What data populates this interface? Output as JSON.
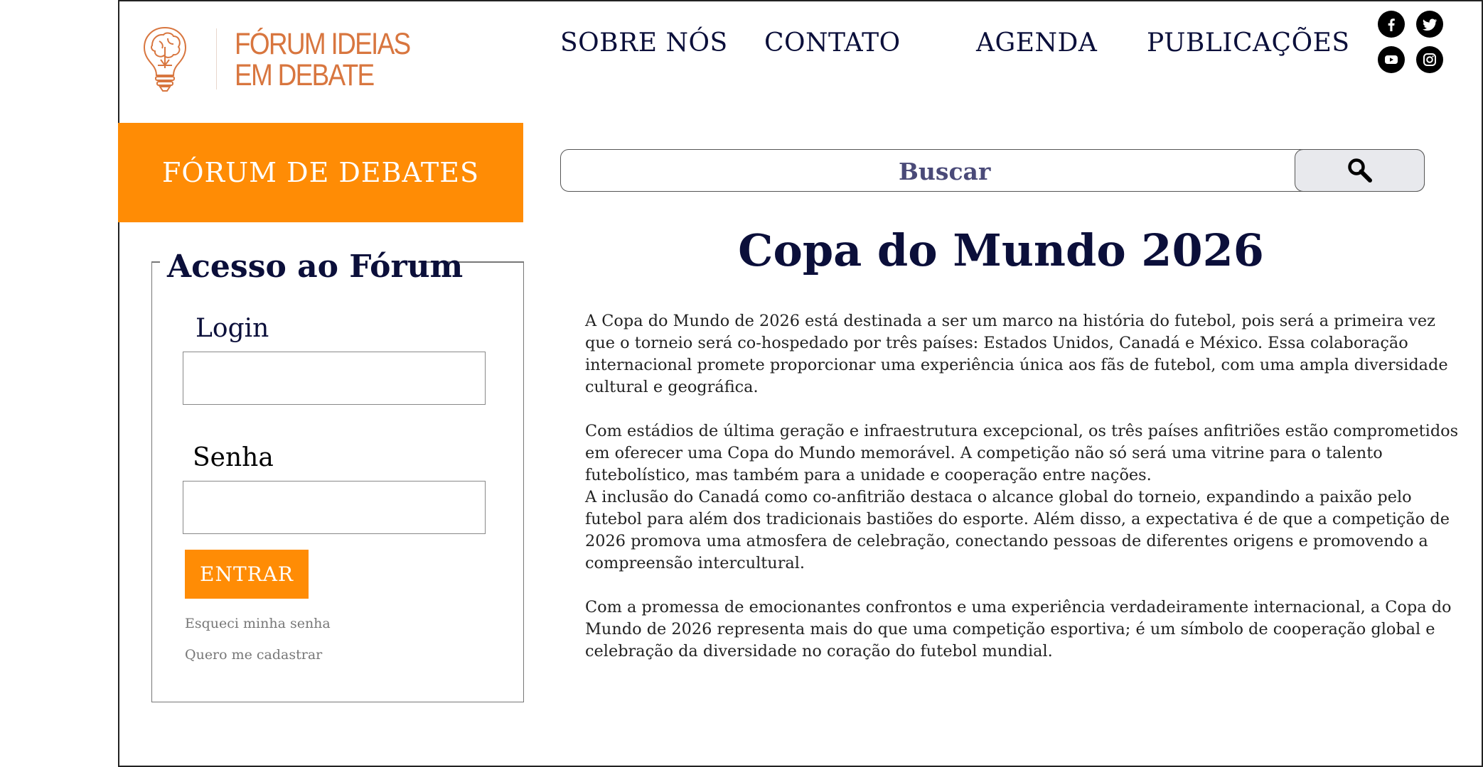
{
  "header": {
    "logo_text_line1": "FÓRUM IDEIAS",
    "logo_text_line2": "EM DEBATE",
    "nav": [
      "SOBRE NÓS",
      "CONTATO",
      "AGENDA",
      "PUBLICAÇÕES"
    ],
    "social_icons": [
      "facebook-icon",
      "twitter-icon",
      "youtube-icon",
      "instagram-icon"
    ]
  },
  "sidebar": {
    "banner": "FÓRUM DE DEBATES",
    "access_title": "Acesso ao Fórum",
    "login_label": "Login",
    "login_value": "",
    "password_label": "Senha",
    "password_value": "",
    "submit_label": "ENTRAR",
    "forgot_link": "Esqueci minha senha",
    "register_link": "Quero me cadastrar"
  },
  "search": {
    "placeholder": "Buscar",
    "icon": "search-icon"
  },
  "article": {
    "title": "Copa do Mundo 2026",
    "paragraphs": [
      "A Copa do Mundo de 2026 está destinada a ser um marco na história do futebol, pois será a primeira vez que o torneio será co-hospedado por três países: Estados Unidos, Canadá e México. Essa colaboração internacional promete proporcionar uma experiência única aos fãs de futebol, com uma ampla diversidade cultural e geográfica.",
      "Com estádios de última geração e infraestrutura excepcional, os três países anfitriões estão comprometidos em oferecer uma Copa do Mundo memorável. A competição não só será uma vitrine para o talento futebolístico, mas também para a unidade e cooperação entre nações.",
      "A inclusão do Canadá como co-anfitrião destaca o alcance global do torneio, expandindo a paixão pelo futebol para além dos tradicionais bastiões do esporte. Além disso, a expectativa é de que a competição de 2026 promova uma atmosfera de celebração, conectando pessoas de diferentes origens e promovendo a compreensão intercultural.",
      "Com a promessa de emocionantes confrontos e uma experiência verdadeiramente internacional, a Copa do Mundo de 2026 representa mais do que uma competição esportiva; é um símbolo de cooperação global e celebração da diversidade no coração do futebol mundial."
    ]
  },
  "colors": {
    "accent": "#ff8c05",
    "text_dark": "#0b0f3a",
    "logo": "#d8763f"
  }
}
